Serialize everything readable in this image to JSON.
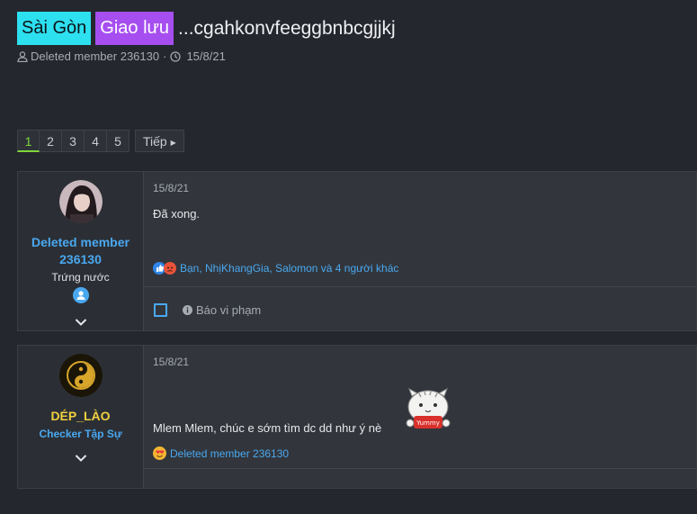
{
  "thread": {
    "prefix_1": "Sài Gòn",
    "prefix_2": "Giao lưu",
    "title": "...cgahkonvfeeggbnbcgjjkj",
    "starter": "Deleted member 236130",
    "date": "15/8/21"
  },
  "pagination": {
    "pages": [
      "1",
      "2",
      "3",
      "4",
      "5"
    ],
    "current": "1",
    "next_label": "Tiếp"
  },
  "posts": [
    {
      "user": {
        "name": "Deleted member 236130",
        "title": "Trứng nước",
        "name_color": "#4aa8f0"
      },
      "date": "15/8/21",
      "text": "Đã xong.",
      "reactions": "Bạn, NhịKhangGia, Salomon và 4 người khác",
      "report_label": "Báo vi phạm"
    },
    {
      "user": {
        "name": "DÉP_LÀO",
        "title": "Checker Tập Sự",
        "name_color": "#f0d040"
      },
      "date": "15/8/21",
      "text": "Mlem Mlem, chúc e sớm tìm dc dd như ý nè",
      "reactions": "Deleted member 236130",
      "sticker_text": "Yummy"
    }
  ],
  "colors": {
    "accent": "#4aa8f0",
    "active_page": "#7fd63a",
    "prefix_1_bg": "#2de0f0",
    "prefix_2_bg": "#a64ef0"
  }
}
